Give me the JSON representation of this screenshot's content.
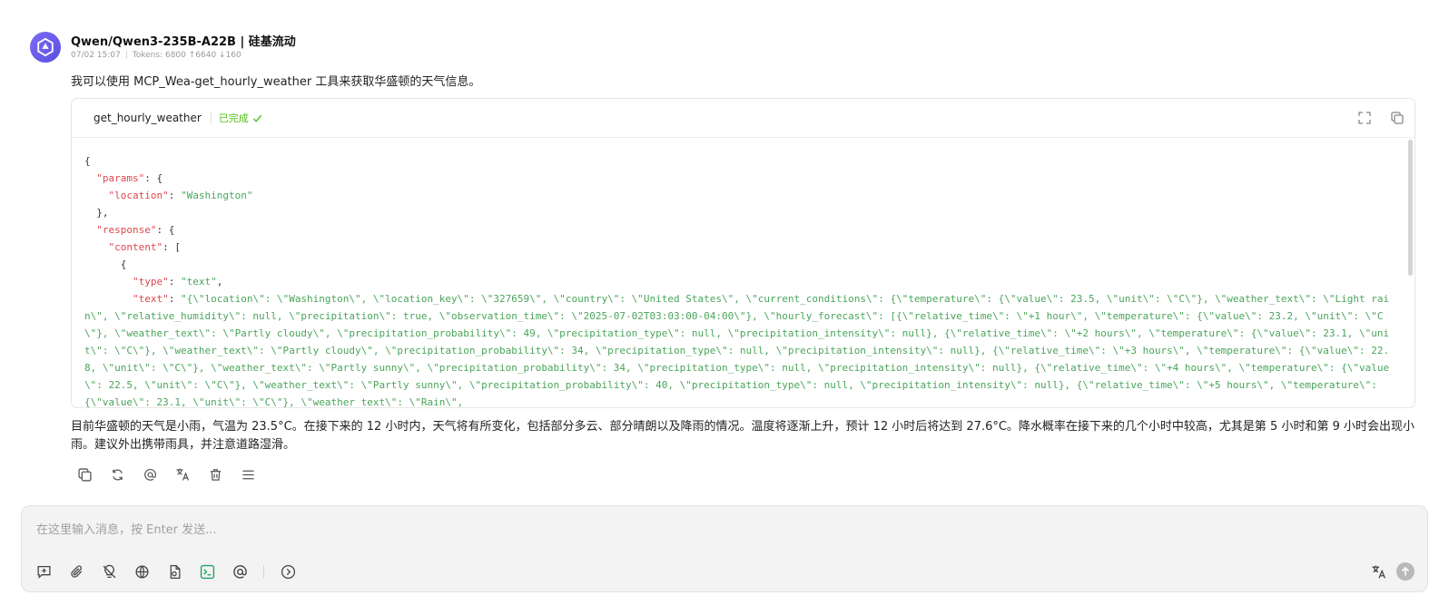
{
  "message": {
    "model_name": "Qwen/Qwen3-235B-A22B | 硅基流动",
    "timestamp": "07/02 15:07",
    "tokens": "Tokens: 6800 ↑6640 ↓160",
    "intro": "我可以使用 MCP_Wea-get_hourly_weather 工具来获取华盛顿的天气信息。",
    "tool_call": {
      "name": "get_hourly_weather",
      "status": "已完成"
    },
    "code": {
      "l1": "{",
      "k_params": "\"params\"",
      "l2_tail": ": {",
      "k_location": "\"location\"",
      "colon": ": ",
      "v_location": "\"Washington\"",
      "l4": "},",
      "k_response": "\"response\"",
      "l5_tail": ": {",
      "k_content": "\"content\"",
      "l6_tail": ": [",
      "l7": "{",
      "k_type": "\"type\"",
      "v_type": "\"text\"",
      "comma": ",",
      "k_text": "\"text\"",
      "v_text": "\"{\\\"location\\\": \\\"Washington\\\", \\\"location_key\\\": \\\"327659\\\", \\\"country\\\": \\\"United States\\\", \\\"current_conditions\\\": {\\\"temperature\\\": {\\\"value\\\": 23.5, \\\"unit\\\": \\\"C\\\"}, \\\"weather_text\\\": \\\"Light rain\\\", \\\"relative_humidity\\\": null, \\\"precipitation\\\": true, \\\"observation_time\\\": \\\"2025-07-02T03:03:00-04:00\\\"}, \\\"hourly_forecast\\\": [{\\\"relative_time\\\": \\\"+1 hour\\\", \\\"temperature\\\": {\\\"value\\\": 23.2, \\\"unit\\\": \\\"C\\\"}, \\\"weather_text\\\": \\\"Partly cloudy\\\", \\\"precipitation_probability\\\": 49, \\\"precipitation_type\\\": null, \\\"precipitation_intensity\\\": null}, {\\\"relative_time\\\": \\\"+2 hours\\\", \\\"temperature\\\": {\\\"value\\\": 23.1, \\\"unit\\\": \\\"C\\\"}, \\\"weather_text\\\": \\\"Partly cloudy\\\", \\\"precipitation_probability\\\": 34, \\\"precipitation_type\\\": null, \\\"precipitation_intensity\\\": null}, {\\\"relative_time\\\": \\\"+3 hours\\\", \\\"temperature\\\": {\\\"value\\\": 22.8, \\\"unit\\\": \\\"C\\\"}, \\\"weather_text\\\": \\\"Partly sunny\\\", \\\"precipitation_probability\\\": 34, \\\"precipitation_type\\\": null, \\\"precipitation_intensity\\\": null}, {\\\"relative_time\\\": \\\"+4 hours\\\", \\\"temperature\\\": {\\\"value\\\": 22.5, \\\"unit\\\": \\\"C\\\"}, \\\"weather_text\\\": \\\"Partly sunny\\\", \\\"precipitation_probability\\\": 40, \\\"precipitation_type\\\": null, \\\"precipitation_intensity\\\": null}, {\\\"relative_time\\\": \\\"+5 hours\\\", \\\"temperature\\\": {\\\"value\\\": 23.1, \\\"unit\\\": \\\"C\\\"}, \\\"weather_text\\\": \\\"Rain\\\","
    },
    "summary": "目前华盛顿的天气是小雨，气温为 23.5°C。在接下来的 12 小时内，天气将有所变化，包括部分多云、部分晴朗以及降雨的情况。温度将逐渐上升，预计 12 小时后将达到 27.6°C。降水概率在接下来的几个小时中较高，尤其是第 5 小时和第 9 小时会出现小雨。建议外出携带雨具，并注意道路湿滑。"
  },
  "input": {
    "placeholder": "在这里输入消息，按 Enter 发送..."
  },
  "colors": {
    "accent": "#6a5ae8",
    "success": "#52c41a",
    "json_key": "#e0464c",
    "json_string": "#4aa55a"
  },
  "icons": {
    "header": [
      "expand-icon",
      "copy-icon"
    ],
    "message_actions": [
      "copy-icon",
      "regenerate-icon",
      "mention-icon",
      "translate-icon",
      "delete-icon",
      "menu-icon"
    ],
    "input_toolbar": [
      "new-topic-icon",
      "attachment-icon",
      "thinking-icon",
      "web-search-icon",
      "knowledge-icon",
      "mcp-terminal-icon",
      "mention-icon",
      "more-icon"
    ],
    "input_right": [
      "translate-icon",
      "send-icon"
    ]
  }
}
